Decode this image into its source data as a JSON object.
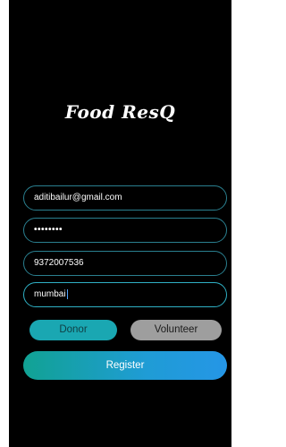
{
  "app": {
    "logo_text": "Food ResQ"
  },
  "form": {
    "email_value": "aditibailur@gmail.com",
    "password_value": "••••••••",
    "phone_value": "9372007536",
    "city_value": "mumbai"
  },
  "roles": {
    "donor_label": "Donor",
    "volunteer_label": "Volunteer"
  },
  "actions": {
    "register_label": "Register"
  },
  "colors": {
    "background": "#000000",
    "field_border": "#2a7f8f",
    "donor_selected": "#1aa7b2",
    "volunteer": "#9e9e9e",
    "register_gradient_start": "#11a293",
    "register_gradient_end": "#2596e6"
  }
}
